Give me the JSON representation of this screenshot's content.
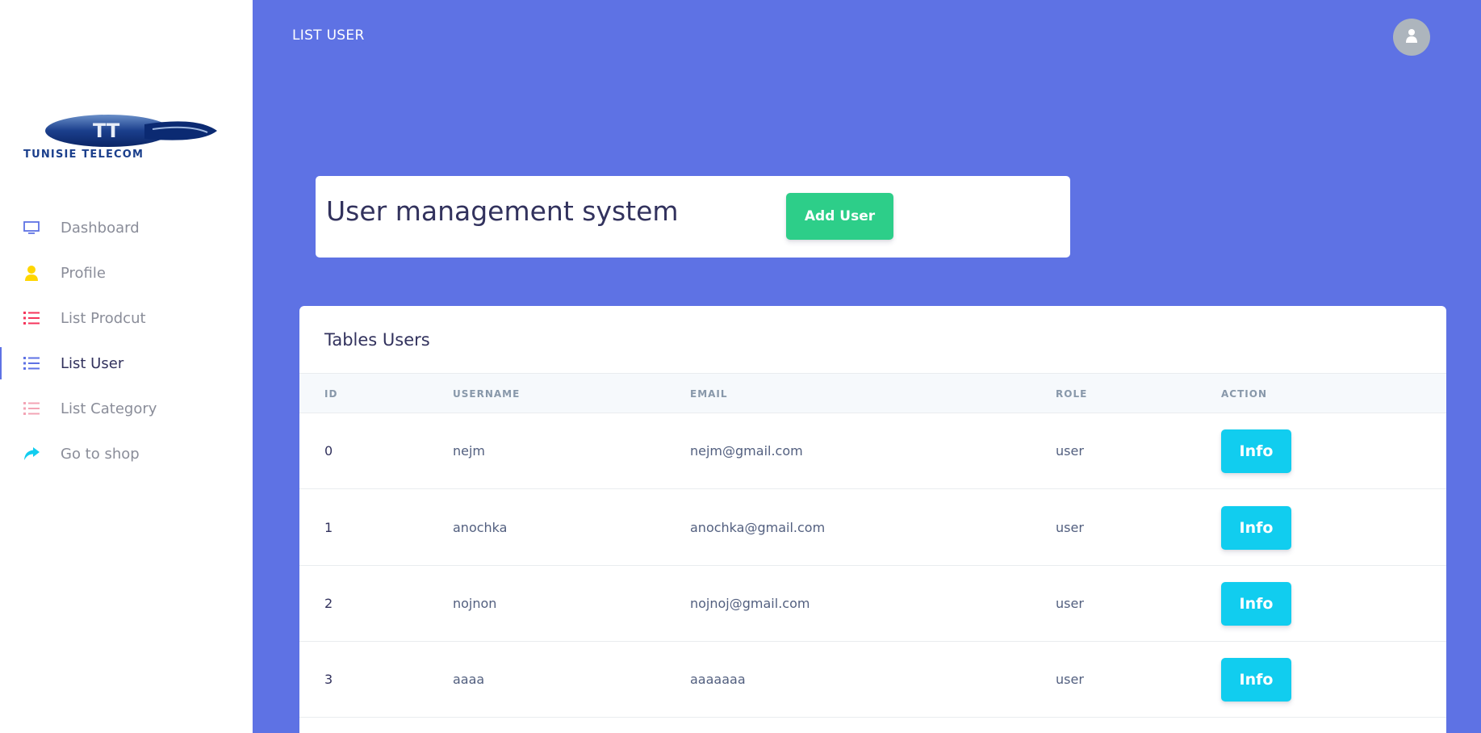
{
  "brand": {
    "logo_text": "TUNISIE TELECOM"
  },
  "sidebar": {
    "items": [
      {
        "label": "Dashboard",
        "icon": "monitor-icon",
        "color": "#5e72e4"
      },
      {
        "label": "Profile",
        "icon": "user-icon",
        "color": "#ffd600"
      },
      {
        "label": "List Prodcut",
        "icon": "list-icon",
        "color": "#f5365c"
      },
      {
        "label": "List User",
        "icon": "list-icon",
        "color": "#5e72e4",
        "active": true
      },
      {
        "label": "List Category",
        "icon": "list-icon",
        "color": "#f3a4b5"
      },
      {
        "label": "Go to shop",
        "icon": "share-arrow-icon",
        "color": "#11cdef"
      }
    ]
  },
  "topbar": {
    "title": "LIST USER",
    "avatar_icon": "user-avatar-icon"
  },
  "header_card": {
    "title": "User management system",
    "add_button": "Add User"
  },
  "table": {
    "title": "Tables Users",
    "columns": [
      "ID",
      "USERNAME",
      "EMAIL",
      "ROLE",
      "ACTION"
    ],
    "rows": [
      {
        "id": "0",
        "username": "nejm",
        "email": "nejm@gmail.com",
        "role": "user",
        "action": "Info"
      },
      {
        "id": "1",
        "username": "anochka",
        "email": "anochka@gmail.com",
        "role": "user",
        "action": "Info"
      },
      {
        "id": "2",
        "username": "nojnon",
        "email": "nojnoj@gmail.com",
        "role": "user",
        "action": "Info"
      },
      {
        "id": "3",
        "username": "aaaa",
        "email": "aaaaaaa",
        "role": "user",
        "action": "Info"
      }
    ]
  },
  "colors": {
    "primary": "#5e72e4",
    "success": "#2dce89",
    "info": "#11cdef"
  }
}
